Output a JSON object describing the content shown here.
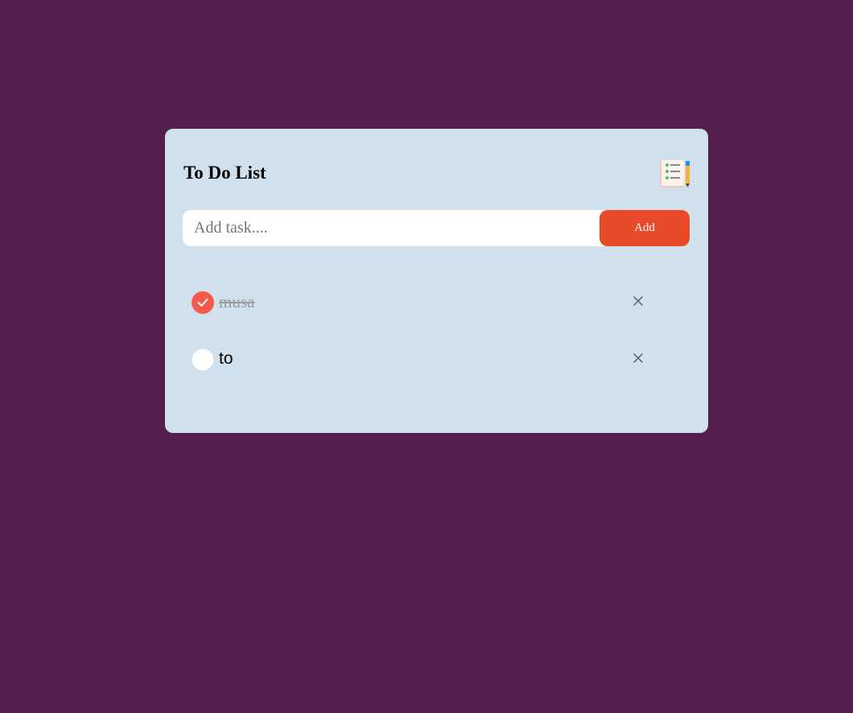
{
  "app": {
    "title": "To Do List",
    "title_icon": "notepad-checklist-icon"
  },
  "input": {
    "placeholder": "Add task....",
    "value": "",
    "add_label": "Add"
  },
  "tasks": [
    {
      "text": "musa",
      "done": true
    },
    {
      "text": "to",
      "done": false
    }
  ],
  "colors": {
    "background": "#531e4b",
    "card": "#d0e0ed",
    "accent": "#e64a29",
    "check_done": "#f35a4a"
  }
}
